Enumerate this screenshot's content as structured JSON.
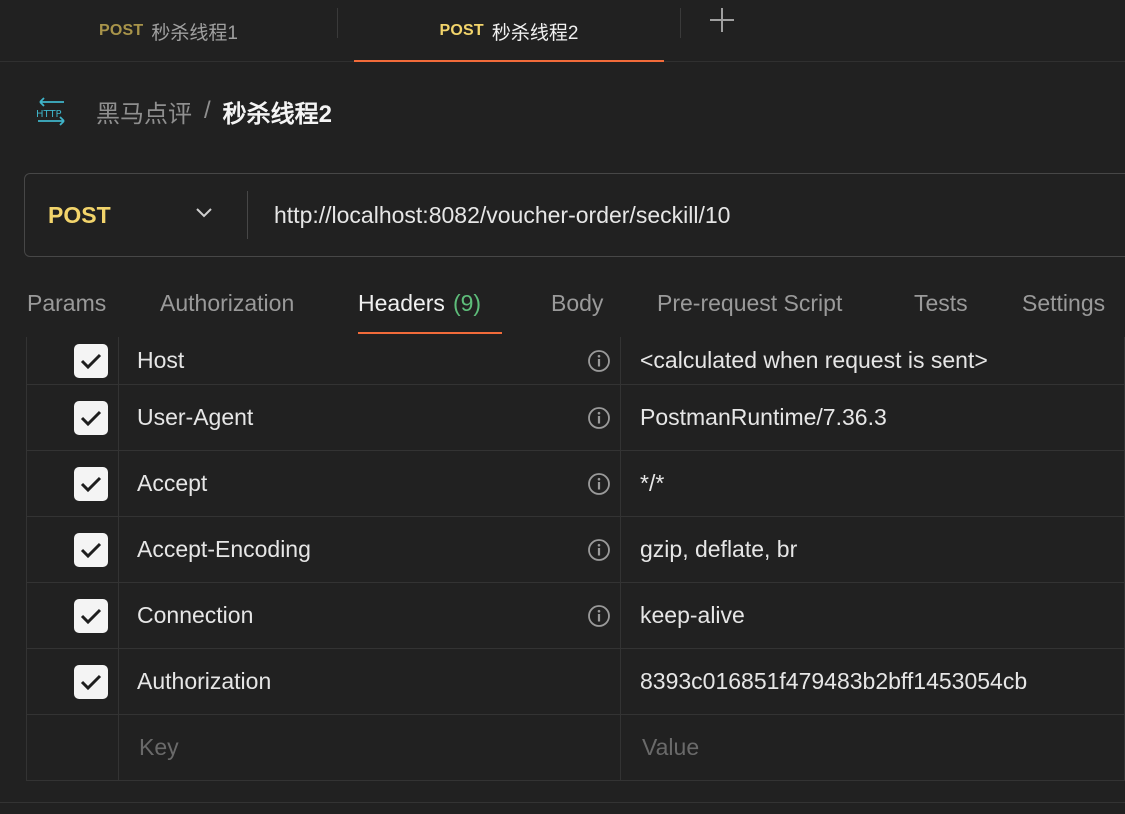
{
  "tabs": [
    {
      "method": "POST",
      "title": "秒杀线程1",
      "active": false
    },
    {
      "method": "POST",
      "title": "秒杀线程2",
      "active": true
    }
  ],
  "breadcrumb": {
    "icon": "http-icon",
    "parent": "黑马点评",
    "separator": "/",
    "current": "秒杀线程2"
  },
  "request": {
    "method": "POST",
    "url": "http://localhost:8082/voucher-order/seckill/10"
  },
  "request_tabs": {
    "params": "Params",
    "authorization": "Authorization",
    "headers": "Headers",
    "headers_count": "(9)",
    "body": "Body",
    "prerequest": "Pre-request Script",
    "tests": "Tests",
    "settings": "Settings"
  },
  "headers": [
    {
      "key": "Host",
      "value": "<calculated when request is sent>",
      "checked": true,
      "info": true
    },
    {
      "key": "User-Agent",
      "value": "PostmanRuntime/7.36.3",
      "checked": true,
      "info": true
    },
    {
      "key": "Accept",
      "value": "*/*",
      "checked": true,
      "info": true
    },
    {
      "key": "Accept-Encoding",
      "value": "gzip, deflate, br",
      "checked": true,
      "info": true
    },
    {
      "key": "Connection",
      "value": "keep-alive",
      "checked": true,
      "info": true
    },
    {
      "key": "Authorization",
      "value": "8393c016851f479483b2bff1453054cb",
      "checked": true,
      "info": false
    }
  ],
  "new_row": {
    "key_placeholder": "Key",
    "value_placeholder": "Value"
  },
  "colors": {
    "background": "#212121",
    "method_post": "#f2d46b",
    "active_tab_accent": "#f26b3a",
    "count_green": "#5ebd7a",
    "http_icon": "#3fb4c9"
  }
}
